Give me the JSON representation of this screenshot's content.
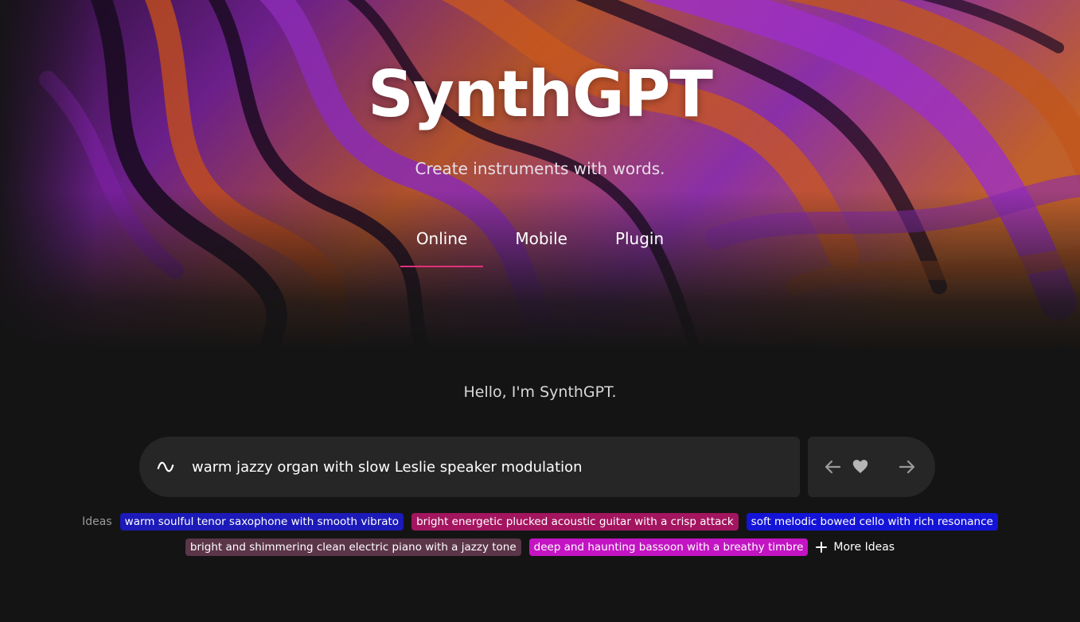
{
  "app": {
    "title": "SynthGPT",
    "subtitle": "Create instruments with words."
  },
  "tabs": [
    {
      "label": "Online",
      "active": true
    },
    {
      "label": "Mobile",
      "active": false
    },
    {
      "label": "Plugin",
      "active": false
    }
  ],
  "greeting": "Hello, I'm SynthGPT.",
  "prompt": {
    "value": "warm jazzy organ with slow Leslie speaker modulation",
    "icon": "wave-icon"
  },
  "controls": {
    "prev_icon": "arrow-left-icon",
    "favorite_icon": "heart-icon",
    "next_icon": "arrow-right-icon"
  },
  "ideas": {
    "label": "Ideas",
    "chips": [
      {
        "text": "warm soulful tenor saxophone with smooth vibrato",
        "color": "#1c1ab8"
      },
      {
        "text": "bright energetic plucked acoustic guitar with a crisp attack",
        "color": "#a3155f"
      },
      {
        "text": "soft melodic bowed cello with rich resonance",
        "color": "#1414d8"
      },
      {
        "text": "bright and shimmering clean electric piano with a jazzy tone",
        "color": "#5b3548"
      },
      {
        "text": "deep and haunting bassoon with a breathy timbre",
        "color": "#c314c3"
      }
    ],
    "more_label": "More Ideas"
  },
  "colors": {
    "accent": "#e0307a",
    "background": "#141414",
    "bar": "#262626"
  }
}
